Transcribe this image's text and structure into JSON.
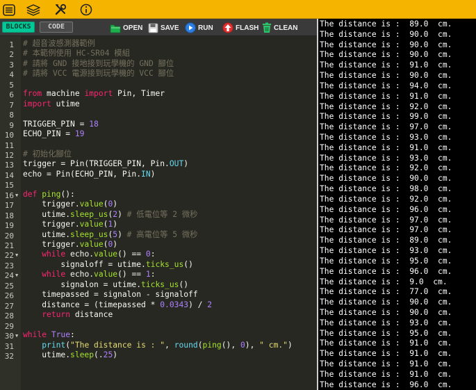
{
  "menubar": {
    "items": [
      {
        "icon": "menu-icon"
      },
      {
        "icon": "layers-icon"
      },
      {
        "icon": "tools-icon"
      },
      {
        "icon": "info-icon"
      }
    ]
  },
  "toolbar": {
    "blocks_label": "BLOCKS",
    "code_label": "CODE",
    "open_label": "OPEN",
    "save_label": "SAVE",
    "run_label": "RUN",
    "flash_label": "FLASH",
    "clean_label": "CLEAN"
  },
  "editor": {
    "lines": [
      {
        "no": "1",
        "fold": false,
        "tokens": [
          {
            "t": "# 超音波感測器範例",
            "c": "c"
          }
        ]
      },
      {
        "no": "2",
        "fold": false,
        "tokens": [
          {
            "t": "# 本範例使用 HC-SR04 模組",
            "c": "c"
          }
        ]
      },
      {
        "no": "3",
        "fold": false,
        "tokens": [
          {
            "t": "# 請將 GND 接地接到玩學機的 GND 腳位",
            "c": "c"
          }
        ]
      },
      {
        "no": "4",
        "fold": false,
        "tokens": [
          {
            "t": "# 請將 VCC 電源接到玩學機的 VCC 腳位",
            "c": "c"
          }
        ]
      },
      {
        "no": "5",
        "fold": false,
        "tokens": []
      },
      {
        "no": "6",
        "fold": false,
        "tokens": [
          {
            "t": "from",
            "c": "k"
          },
          {
            "t": " machine "
          },
          {
            "t": "import",
            "c": "k"
          },
          {
            "t": " Pin, Timer"
          }
        ]
      },
      {
        "no": "7",
        "fold": false,
        "tokens": [
          {
            "t": "import",
            "c": "k"
          },
          {
            "t": " utime"
          }
        ]
      },
      {
        "no": "8",
        "fold": false,
        "tokens": []
      },
      {
        "no": "9",
        "fold": false,
        "tokens": [
          {
            "t": "TRIGGER_PIN = "
          },
          {
            "t": "18",
            "c": "n"
          }
        ]
      },
      {
        "no": "10",
        "fold": false,
        "tokens": [
          {
            "t": "ECHO_PIN = "
          },
          {
            "t": "19",
            "c": "n"
          }
        ]
      },
      {
        "no": "11",
        "fold": false,
        "tokens": []
      },
      {
        "no": "12",
        "fold": false,
        "tokens": [
          {
            "t": "# 初始化腳位",
            "c": "c"
          }
        ]
      },
      {
        "no": "13",
        "fold": false,
        "tokens": [
          {
            "t": "trigger = Pin(TRIGGER_PIN, Pin."
          },
          {
            "t": "OUT",
            "c": "b"
          },
          {
            "t": ")"
          }
        ]
      },
      {
        "no": "14",
        "fold": false,
        "tokens": [
          {
            "t": "echo = Pin(ECHO_PIN, Pin."
          },
          {
            "t": "IN",
            "c": "b"
          },
          {
            "t": ")"
          }
        ]
      },
      {
        "no": "15",
        "fold": false,
        "tokens": []
      },
      {
        "no": "16",
        "fold": true,
        "tokens": [
          {
            "t": "def",
            "c": "k"
          },
          {
            "t": " "
          },
          {
            "t": "ping",
            "c": "f"
          },
          {
            "t": "():"
          }
        ]
      },
      {
        "no": "17",
        "fold": false,
        "tokens": [
          {
            "t": "    trigger."
          },
          {
            "t": "value",
            "c": "f"
          },
          {
            "t": "("
          },
          {
            "t": "0",
            "c": "n"
          },
          {
            "t": ")"
          }
        ]
      },
      {
        "no": "18",
        "fold": false,
        "tokens": [
          {
            "t": "    utime."
          },
          {
            "t": "sleep_us",
            "c": "f"
          },
          {
            "t": "("
          },
          {
            "t": "2",
            "c": "n"
          },
          {
            "t": ") "
          },
          {
            "t": "# 低電位等 2 微秒",
            "c": "c"
          }
        ]
      },
      {
        "no": "19",
        "fold": false,
        "tokens": [
          {
            "t": "    trigger."
          },
          {
            "t": "value",
            "c": "f"
          },
          {
            "t": "("
          },
          {
            "t": "1",
            "c": "n"
          },
          {
            "t": ")"
          }
        ]
      },
      {
        "no": "20",
        "fold": false,
        "tokens": [
          {
            "t": "    utime."
          },
          {
            "t": "sleep_us",
            "c": "f"
          },
          {
            "t": "("
          },
          {
            "t": "5",
            "c": "n"
          },
          {
            "t": ") "
          },
          {
            "t": "# 高電位等 5 微秒",
            "c": "c"
          }
        ]
      },
      {
        "no": "21",
        "fold": false,
        "tokens": [
          {
            "t": "    trigger."
          },
          {
            "t": "value",
            "c": "f"
          },
          {
            "t": "("
          },
          {
            "t": "0",
            "c": "n"
          },
          {
            "t": ")"
          }
        ]
      },
      {
        "no": "22",
        "fold": true,
        "tokens": [
          {
            "t": "    "
          },
          {
            "t": "while",
            "c": "k"
          },
          {
            "t": " echo."
          },
          {
            "t": "value",
            "c": "f"
          },
          {
            "t": "() == "
          },
          {
            "t": "0",
            "c": "n"
          },
          {
            "t": ":"
          }
        ]
      },
      {
        "no": "23",
        "fold": false,
        "tokens": [
          {
            "t": "        signaloff = utime."
          },
          {
            "t": "ticks_us",
            "c": "f"
          },
          {
            "t": "()"
          }
        ]
      },
      {
        "no": "24",
        "fold": true,
        "tokens": [
          {
            "t": "    "
          },
          {
            "t": "while",
            "c": "k"
          },
          {
            "t": " echo."
          },
          {
            "t": "value",
            "c": "f"
          },
          {
            "t": "() == "
          },
          {
            "t": "1",
            "c": "n"
          },
          {
            "t": ":"
          }
        ]
      },
      {
        "no": "25",
        "fold": false,
        "tokens": [
          {
            "t": "        signalon = utime."
          },
          {
            "t": "ticks_us",
            "c": "f"
          },
          {
            "t": "()"
          }
        ]
      },
      {
        "no": "26",
        "fold": false,
        "tokens": [
          {
            "t": "    timepassed = signalon - signaloff"
          }
        ]
      },
      {
        "no": "27",
        "fold": false,
        "tokens": [
          {
            "t": "    distance = (timepassed * "
          },
          {
            "t": "0.0343",
            "c": "n"
          },
          {
            "t": ") / "
          },
          {
            "t": "2",
            "c": "n"
          }
        ]
      },
      {
        "no": "28",
        "fold": false,
        "tokens": [
          {
            "t": "    "
          },
          {
            "t": "return",
            "c": "k"
          },
          {
            "t": " distance"
          }
        ]
      },
      {
        "no": "29",
        "fold": false,
        "tokens": []
      },
      {
        "no": "30",
        "fold": true,
        "tokens": [
          {
            "t": "while",
            "c": "k"
          },
          {
            "t": " "
          },
          {
            "t": "True",
            "c": "n"
          },
          {
            "t": ":"
          }
        ]
      },
      {
        "no": "31",
        "fold": false,
        "tokens": [
          {
            "t": "    "
          },
          {
            "t": "print",
            "c": "b"
          },
          {
            "t": "("
          },
          {
            "t": "\"The distance is : \"",
            "c": "s"
          },
          {
            "t": ", "
          },
          {
            "t": "round",
            "c": "b"
          },
          {
            "t": "("
          },
          {
            "t": "ping",
            "c": "f"
          },
          {
            "t": "(), "
          },
          {
            "t": "0",
            "c": "n"
          },
          {
            "t": "), "
          },
          {
            "t": "\" cm.\"",
            "c": "s"
          },
          {
            "t": ")"
          }
        ]
      },
      {
        "no": "32",
        "fold": false,
        "tokens": [
          {
            "t": "    utime."
          },
          {
            "t": "sleep",
            "c": "f"
          },
          {
            "t": "(."
          },
          {
            "t": "25",
            "c": "n"
          },
          {
            "t": ")"
          }
        ]
      }
    ]
  },
  "console": {
    "lines": [
      "The distance is :  89.0  cm.",
      "The distance is :  90.0  cm.",
      "The distance is :  90.0  cm.",
      "The distance is :  90.0  cm.",
      "The distance is :  91.0  cm.",
      "The distance is :  90.0  cm.",
      "The distance is :  94.0  cm.",
      "The distance is :  91.0  cm.",
      "The distance is :  92.0  cm.",
      "The distance is :  99.0  cm.",
      "The distance is :  97.0  cm.",
      "The distance is :  93.0  cm.",
      "The distance is :  91.0  cm.",
      "The distance is :  93.0  cm.",
      "The distance is :  92.0  cm.",
      "The distance is :  90.0  cm.",
      "The distance is :  98.0  cm.",
      "The distance is :  92.0  cm.",
      "The distance is :  96.0  cm.",
      "The distance is :  97.0  cm.",
      "The distance is :  97.0  cm.",
      "The distance is :  89.0  cm.",
      "The distance is :  93.0  cm.",
      "The distance is :  95.0  cm.",
      "The distance is :  96.0  cm.",
      "The distance is :  9.0  cm.",
      "The distance is :  77.0  cm.",
      "The distance is :  90.0  cm.",
      "The distance is :  90.0  cm.",
      "The distance is :  93.0  cm.",
      "The distance is :  95.0  cm.",
      "The distance is :  91.0  cm.",
      "The distance is :  91.0  cm.",
      "The distance is :  91.0  cm.",
      "The distance is :  91.0  cm.",
      "The distance is :  96.0  cm."
    ]
  }
}
